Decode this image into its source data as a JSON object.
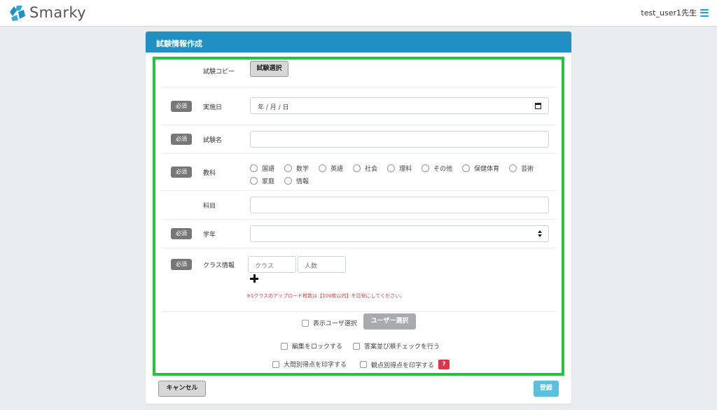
{
  "app": {
    "brand": "Smarky",
    "user_label": "test_user1先生"
  },
  "card": {
    "title": "試験情報作成"
  },
  "form": {
    "copy": {
      "label": "試験コピー",
      "button": "試験選択"
    },
    "required_badge": "必須",
    "date": {
      "label": "実施日",
      "value": "年 / 月 / 日"
    },
    "name": {
      "label": "試験名",
      "value": ""
    },
    "subject": {
      "label": "教科",
      "options_row1": [
        "国語",
        "数学",
        "英語",
        "社会",
        "理科",
        "その他",
        "保健体育",
        "芸術"
      ],
      "options_row2": [
        "家庭",
        "情報"
      ]
    },
    "course": {
      "label": "科目",
      "value": ""
    },
    "grade": {
      "label": "学年",
      "selected": ""
    },
    "class_info": {
      "label": "クラス情報",
      "class_placeholder": "クラス",
      "count_placeholder": "人数",
      "note": "※1クラスのアップロード枚数は【100枚以内】を目安にしてください。"
    },
    "options": {
      "display_user": "表示ユーザ選択",
      "user_select_button": "ユーザー選択",
      "lock_edit": "編集をロックする",
      "answer_order_check": "答案並び順チェックを行う",
      "print_question_scores": "大問別得点を印字する",
      "print_viewpoint_scores": "観点別得点を印字する",
      "help_mark": "?"
    }
  },
  "actions": {
    "cancel": "キャンセル",
    "submit": "登録"
  },
  "colors": {
    "header_blue": "#1f8fc4",
    "highlight_green": "#27c340",
    "badge_gray": "#777777",
    "submit_cyan": "#5bc0de",
    "danger_red": "#dc3545"
  }
}
